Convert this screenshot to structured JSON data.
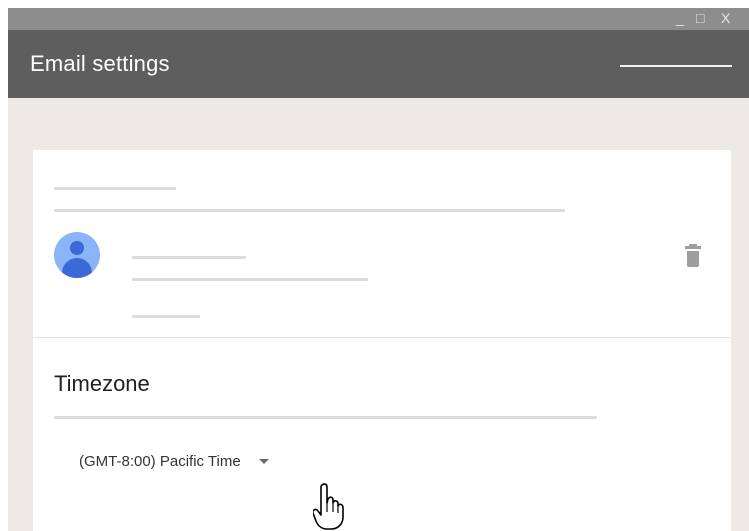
{
  "window": {
    "controls": {
      "minimize": "_",
      "maximize": "□",
      "close": "X"
    }
  },
  "header": {
    "title": "Email settings",
    "menu_icon": "menu-line-icon"
  },
  "account": {
    "avatar_icon": "person-icon",
    "delete_icon": "trash-icon"
  },
  "timezone": {
    "title": "Timezone",
    "value": "(GMT-8:00) Pacific Time",
    "dropdown_icon": "chevron-down-icon"
  },
  "pointer": {
    "icon": "hand-pointer-icon"
  },
  "colors": {
    "header_bg": "#5e5e5e",
    "titlebar_bg": "#8d8d8d",
    "page_bg": "#ece9e6",
    "card_bg": "#ffffff",
    "avatar_bg": "#8ab4f8",
    "avatar_fg": "#3b69d6"
  }
}
